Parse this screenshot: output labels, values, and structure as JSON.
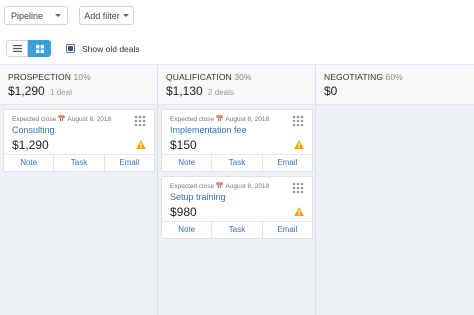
{
  "toolbar": {
    "pipeline_label": "Pipeline",
    "add_filter_label": "Add filter",
    "show_old_deals_label": "Show old deals"
  },
  "columns": [
    {
      "stage": "PROSPECTION",
      "percent": "10%",
      "amount": "$1,290",
      "deals": "1 deal",
      "cards": [
        {
          "close": "Expected close 📅 August 8, 2018",
          "title": "Consulting",
          "value": "$1,290",
          "note": "Note",
          "task": "Task",
          "email": "Email"
        }
      ]
    },
    {
      "stage": "QUALIFICATION",
      "percent": "30%",
      "amount": "$1,130",
      "deals": "2 deals",
      "cards": [
        {
          "close": "Expected close 📅 August 8, 2018",
          "title": "Implementation fee",
          "value": "$150",
          "note": "Note",
          "task": "Task",
          "email": "Email"
        },
        {
          "close": "Expected close 📅 August 8, 2018",
          "title": "Setup training",
          "value": "$980",
          "note": "Note",
          "task": "Task",
          "email": "Email"
        }
      ]
    },
    {
      "stage": "NEGOTIATING",
      "percent": "60%",
      "amount": "$0",
      "deals": "",
      "cards": []
    }
  ],
  "colors": {
    "accent": "#3b9fd9",
    "link": "#3b6fb6",
    "warning": "#f0a21c"
  }
}
